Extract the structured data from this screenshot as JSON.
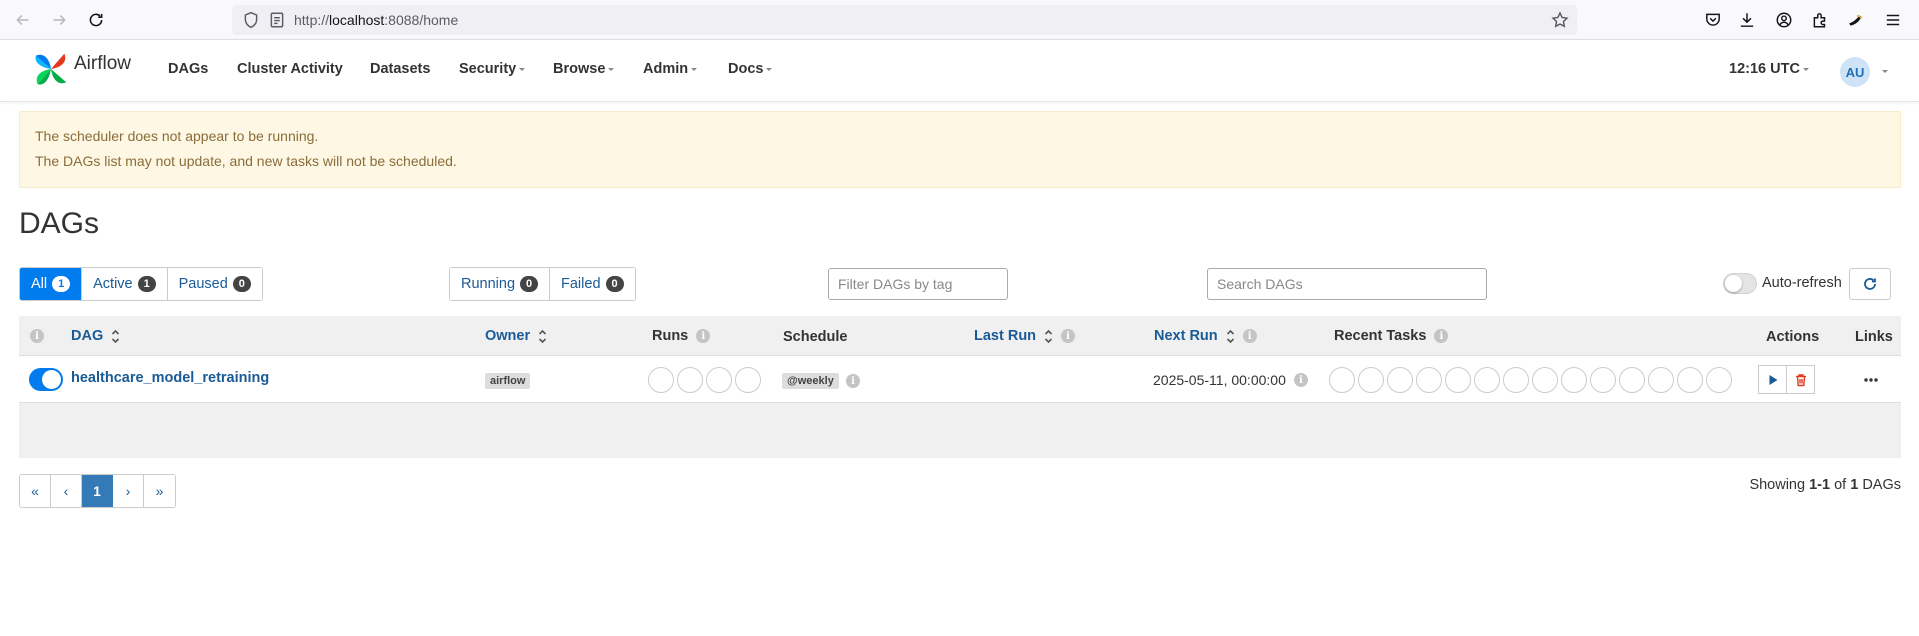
{
  "browser": {
    "url_prefix": "http://",
    "url_host": "localhost",
    "url_suffix": ":8088/home"
  },
  "nav": {
    "brand": "Airflow",
    "items": [
      {
        "label": "DAGs",
        "dropdown": false
      },
      {
        "label": "Cluster Activity",
        "dropdown": false
      },
      {
        "label": "Datasets",
        "dropdown": false
      },
      {
        "label": "Security",
        "dropdown": true
      },
      {
        "label": "Browse",
        "dropdown": true
      },
      {
        "label": "Admin",
        "dropdown": true
      },
      {
        "label": "Docs",
        "dropdown": true
      }
    ],
    "clock": "12:16 UTC",
    "user_initials": "AU"
  },
  "alert": {
    "line1": "The scheduler does not appear to be running.",
    "line2": "The DAGs list may not update, and new tasks will not be scheduled.",
    "color": "#8a6d3b"
  },
  "page_title": "DAGs",
  "filters": {
    "status": [
      {
        "label": "All",
        "count": "1",
        "active": true
      },
      {
        "label": "Active",
        "count": "1",
        "active": false
      },
      {
        "label": "Paused",
        "count": "0",
        "active": false
      }
    ],
    "run_state": [
      {
        "label": "Running",
        "count": "0"
      },
      {
        "label": "Failed",
        "count": "0"
      }
    ],
    "tag_placeholder": "Filter DAGs by tag",
    "search_placeholder": "Search DAGs",
    "auto_refresh_label": "Auto-refresh",
    "auto_refresh_on": false
  },
  "table": {
    "headers": {
      "dag": "DAG",
      "owner": "Owner",
      "runs": "Runs",
      "schedule": "Schedule",
      "last_run": "Last Run",
      "next_run": "Next Run",
      "recent_tasks": "Recent Tasks",
      "actions": "Actions",
      "links": "Links"
    },
    "rows": [
      {
        "enabled": true,
        "dag_id": "healthcare_model_retraining",
        "owner": "airflow",
        "runs_circles": 4,
        "schedule": "@weekly",
        "last_run": "",
        "next_run": "2025-05-11, 00:00:00",
        "recent_task_circles": 14
      }
    ]
  },
  "pagination": {
    "first": "«",
    "prev": "‹",
    "current": "1",
    "next": "›",
    "last": "»"
  },
  "showing": {
    "prefix": "Showing",
    "range": "1-1",
    "of": "of",
    "total": "1",
    "suffix": "DAGs"
  },
  "colors": {
    "primary": "#017cee",
    "link": "#1a5a96",
    "delete": "#e43921",
    "alert_bg": "#fdf7e3"
  }
}
